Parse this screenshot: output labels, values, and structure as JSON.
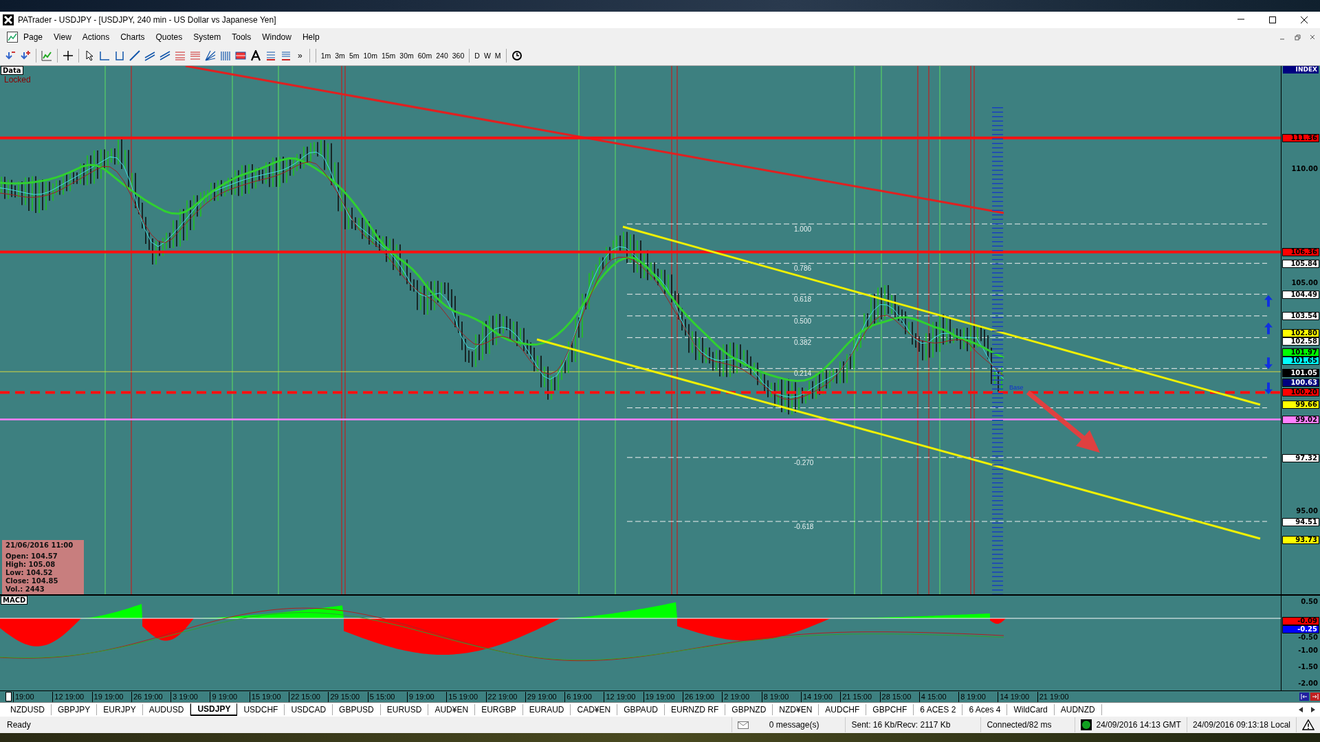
{
  "window": {
    "title": "PATrader - USDJPY - [USDJPY, 240 min - US Dollar vs Japanese Yen]"
  },
  "menu": [
    "Page",
    "View",
    "Actions",
    "Charts",
    "Quotes",
    "System",
    "Tools",
    "Window",
    "Help"
  ],
  "toolbar": {
    "overflow": "»",
    "timeframes": [
      "1m",
      "3m",
      "5m",
      "10m",
      "15m",
      "30m",
      "60m",
      "240",
      "360"
    ],
    "periods": [
      "D",
      "W",
      "M"
    ]
  },
  "chart": {
    "data_label": "Data",
    "lock_status": "Locked",
    "axis_title": "INDEX",
    "price_labels": [
      {
        "text": "111.36",
        "kind": "marker",
        "color": "#ff0000"
      },
      {
        "text": "110.00",
        "kind": "tick"
      },
      {
        "text": "106.36",
        "kind": "marker",
        "color": "#ff0000"
      },
      {
        "text": "105.84",
        "kind": "marker",
        "color": "#ffffff"
      },
      {
        "text": "105.00",
        "kind": "tick"
      },
      {
        "text": "104.49",
        "kind": "marker",
        "color": "#ffffff"
      },
      {
        "text": "103.54",
        "kind": "marker",
        "color": "#ffffff"
      },
      {
        "text": "102.80",
        "kind": "marker",
        "color": "#ffff00"
      },
      {
        "text": "102.58",
        "kind": "marker",
        "color": "#ffffff"
      },
      {
        "text": "101.97",
        "kind": "marker",
        "color": "#00ff00"
      },
      {
        "text": "101.65",
        "kind": "marker",
        "color": "#00ffff"
      },
      {
        "text": "101.05",
        "kind": "marker",
        "color": "#000000"
      },
      {
        "text": "100.63",
        "kind": "marker",
        "color": "#000080"
      },
      {
        "text": "100.20",
        "kind": "marker",
        "color": "#ff0000"
      },
      {
        "text": "99.66",
        "kind": "marker",
        "color": "#ffff00"
      },
      {
        "text": "99.02",
        "kind": "marker",
        "color": "#ff80ff"
      },
      {
        "text": "97.32",
        "kind": "marker",
        "color": "#ffffff"
      },
      {
        "text": "95.00",
        "kind": "tick"
      },
      {
        "text": "94.51",
        "kind": "marker",
        "color": "#ffffff"
      },
      {
        "text": "93.73",
        "kind": "marker",
        "color": "#ffff00"
      }
    ],
    "fib_levels": [
      "1.000",
      "0.786",
      "0.618",
      "0.500",
      "0.382",
      "0.214",
      "-0.270",
      "-0.618"
    ],
    "base_label": "Base",
    "info": {
      "date": "21/06/2016 11:00",
      "lines": [
        "Open: 104.57",
        "High: 105.08",
        "Low: 104.52",
        "Close: 104.85",
        "Vol.: 2443"
      ]
    }
  },
  "macd": {
    "label": "MACD",
    "axis_labels": [
      {
        "text": "0.50",
        "kind": "tick"
      },
      {
        "text": "-0.09",
        "kind": "marker",
        "color": "#ff0000"
      },
      {
        "text": "-0.25",
        "kind": "marker",
        "color": "#0000ff"
      },
      {
        "text": "-0.50",
        "kind": "tick"
      },
      {
        "text": "-1.00",
        "kind": "tick"
      },
      {
        "text": "-1.50",
        "kind": "tick"
      },
      {
        "text": "-2.00",
        "kind": "tick"
      }
    ]
  },
  "time_axis": [
    "19:00",
    "12 19:00",
    "19 19:00",
    "26 19:00",
    "3 19:00",
    "9 19:00",
    "15 19:00",
    "22 15:00",
    "29 15:00",
    "5 15:00",
    "9 19:00",
    "15 19:00",
    "22 19:00",
    "29 19:00",
    "6 19:00",
    "12 19:00",
    "19 19:00",
    "26 19:00",
    "2 19:00",
    "8 19:00",
    "14 19:00",
    "21 15:00",
    "28 15:00",
    "4 15:00",
    "8 19:00",
    "14 19:00",
    "21 19:00"
  ],
  "symbol_tabs": [
    {
      "label": "NZDUSD",
      "selected": false
    },
    {
      "label": "GBPJPY",
      "selected": false
    },
    {
      "label": "EURJPY",
      "selected": false
    },
    {
      "label": "AUDUSD",
      "selected": false
    },
    {
      "label": "USDJPY",
      "selected": true
    },
    {
      "label": "USDCHF",
      "selected": false
    },
    {
      "label": "USDCAD",
      "selected": false
    },
    {
      "label": "GBPUSD",
      "selected": false
    },
    {
      "label": "EURUSD",
      "selected": false
    },
    {
      "label": "AUD¥EN",
      "selected": false
    },
    {
      "label": "EURGBP",
      "selected": false
    },
    {
      "label": "EURAUD",
      "selected": false
    },
    {
      "label": "CAD¥EN",
      "selected": false
    },
    {
      "label": "GBPAUD",
      "selected": false
    },
    {
      "label": "EURNZD RF",
      "selected": false
    },
    {
      "label": "GBPNZD",
      "selected": false
    },
    {
      "label": "NZD¥EN",
      "selected": false
    },
    {
      "label": "AUDCHF",
      "selected": false
    },
    {
      "label": "GBPCHF",
      "selected": false
    },
    {
      "label": "6 ACES 2",
      "selected": false
    },
    {
      "label": "6 Aces 4",
      "selected": false
    },
    {
      "label": "WildCard",
      "selected": false
    },
    {
      "label": "AUDNZD",
      "selected": false
    }
  ],
  "status_bar": {
    "state": "Ready",
    "messages": "0 message(s)",
    "traffic": "Sent: 16 Kb/Recv: 2117 Kb",
    "connection": "Connected/82 ms",
    "gmt_time": "24/09/2016 14:13 GMT",
    "local_time": "24/09/2016 09:13:18 Local"
  }
}
